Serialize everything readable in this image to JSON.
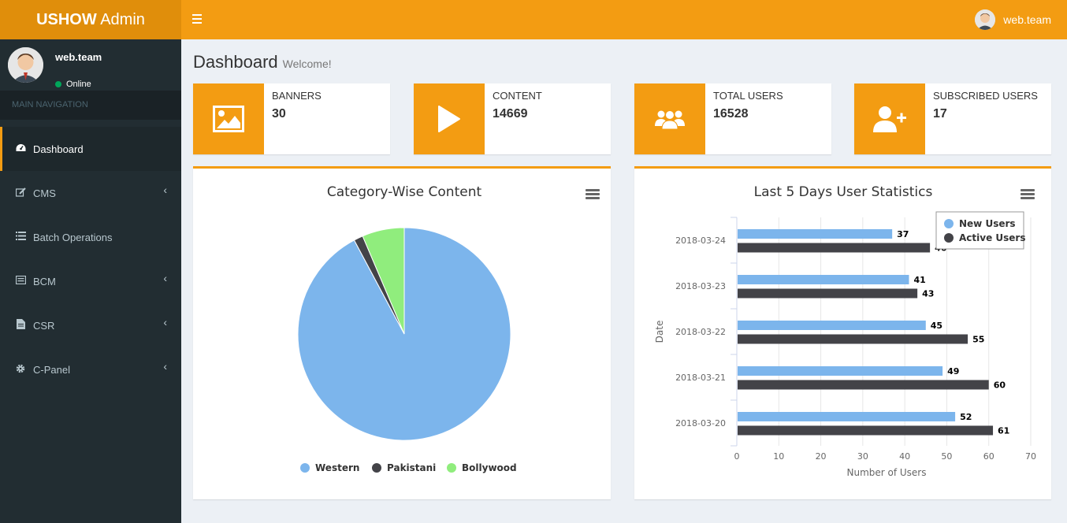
{
  "header": {
    "logo_bold": "USHOW",
    "logo_rest": " Admin",
    "user_name": "web.team"
  },
  "sidebar": {
    "user_name": "web.team",
    "status": "Online",
    "nav_header": "MAIN NAVIGATION",
    "items": [
      {
        "label": "Dashboard",
        "icon": "dashboard-icon"
      },
      {
        "label": "CMS",
        "icon": "edit-icon"
      },
      {
        "label": "Batch Operations",
        "icon": "list-icon"
      },
      {
        "label": "BCM",
        "icon": "list-alt-icon"
      },
      {
        "label": "CSR",
        "icon": "file-icon"
      },
      {
        "label": "C-Panel",
        "icon": "gear-icon"
      }
    ]
  },
  "page": {
    "title": "Dashboard",
    "subtitle": "Welcome!"
  },
  "infoboxes": [
    {
      "label": "BANNERS",
      "value": "30",
      "icon": "image-icon"
    },
    {
      "label": "CONTENT",
      "value": "14669",
      "icon": "play-icon"
    },
    {
      "label": "TOTAL USERS",
      "value": "16528",
      "icon": "users-icon"
    },
    {
      "label": "SUBSCRIBED USERS",
      "value": "17",
      "icon": "user-plus-icon"
    }
  ],
  "colors": {
    "accent": "#f39c12",
    "western": "#7cb5ec",
    "pakistani": "#434348",
    "bollywood": "#90ed7d"
  },
  "chart_data": [
    {
      "type": "pie",
      "title": "Category-Wise Content",
      "categories": [
        "Western",
        "Pakistani",
        "Bollywood"
      ],
      "values": [
        92.2,
        1.4,
        6.4
      ],
      "legend": "bottom"
    },
    {
      "type": "bar",
      "orientation": "horizontal",
      "title": "Last 5 Days User Statistics",
      "categories": [
        "2018-03-24",
        "2018-03-23",
        "2018-03-22",
        "2018-03-21",
        "2018-03-20"
      ],
      "series": [
        {
          "name": "New Users",
          "values": [
            37,
            41,
            45,
            49,
            52
          ]
        },
        {
          "name": "Active Users",
          "values": [
            46,
            43,
            55,
            60,
            61
          ]
        }
      ],
      "ylabel": "Date",
      "xlabel": "Number of Users",
      "xlim": [
        0,
        70
      ],
      "xticks": [
        0,
        10,
        20,
        30,
        40,
        50,
        60,
        70
      ],
      "grid": true,
      "legend": "top-right"
    }
  ]
}
